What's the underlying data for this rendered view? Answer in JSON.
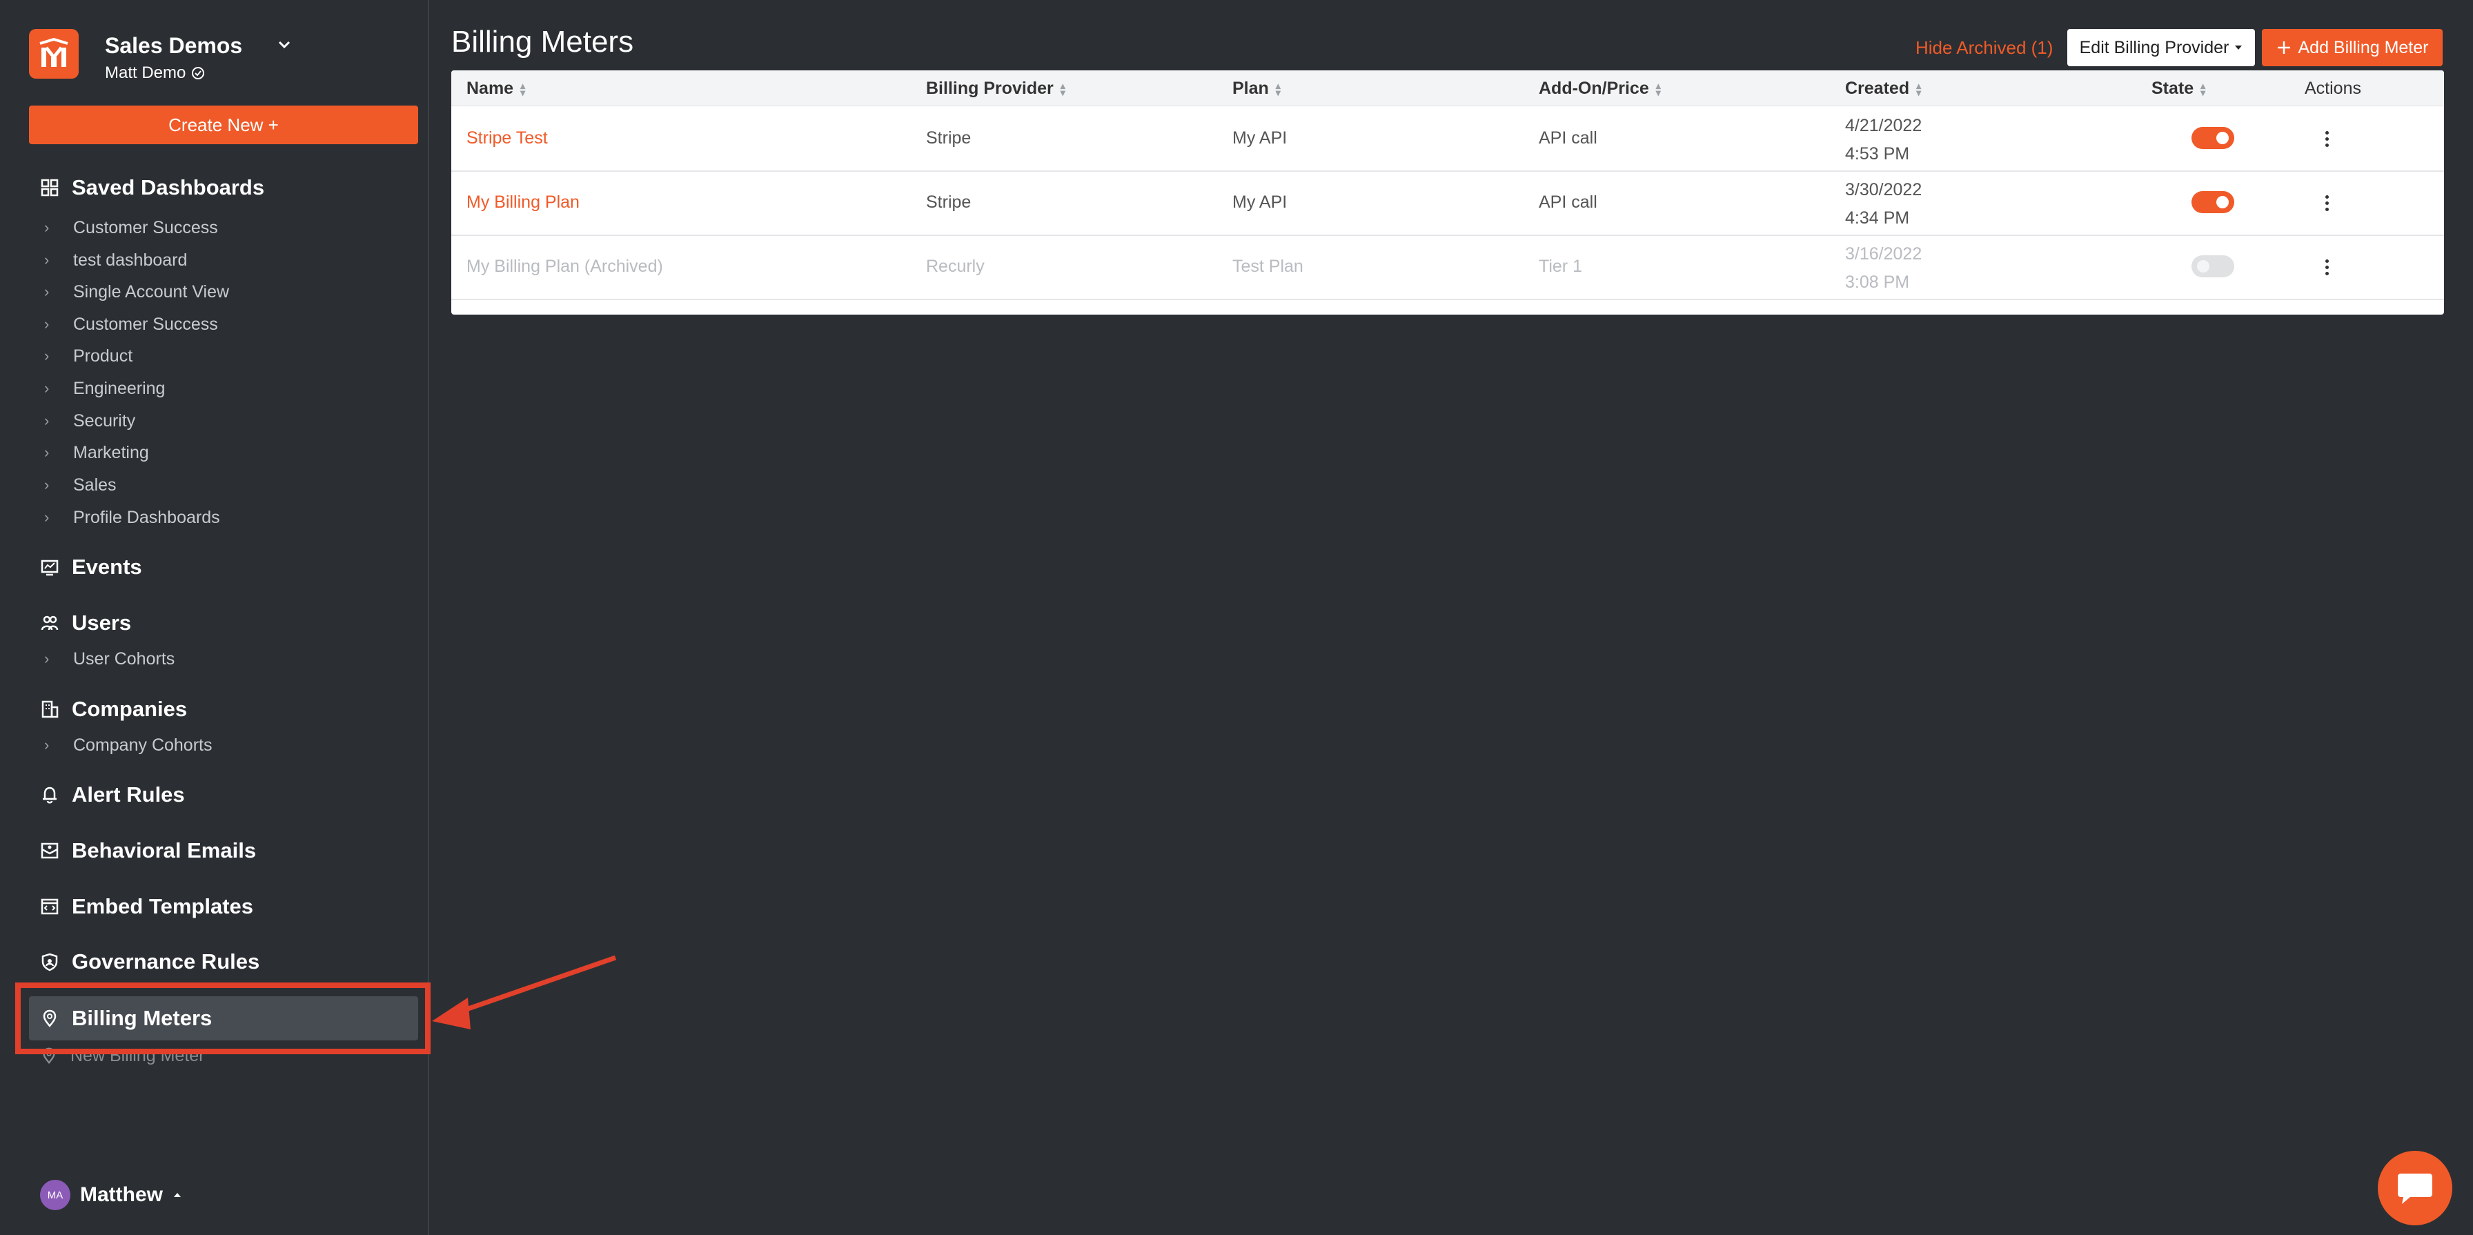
{
  "sidebar": {
    "org_name": "Sales Demos",
    "user_name": "Matt Demo",
    "create_label": "Create New +",
    "saved_dashboards": {
      "label": "Saved Dashboards",
      "items": [
        "Customer Success",
        "test dashboard",
        "Single Account View",
        "Customer Success",
        "Product",
        "Engineering",
        "Security",
        "Marketing",
        "Sales",
        "Profile Dashboards"
      ]
    },
    "events_label": "Events",
    "users": {
      "label": "Users",
      "items": [
        "User Cohorts"
      ]
    },
    "companies": {
      "label": "Companies",
      "items": [
        "Company Cohorts"
      ]
    },
    "alert_rules_label": "Alert Rules",
    "behavioral_emails_label": "Behavioral Emails",
    "embed_templates_label": "Embed Templates",
    "governance_rules_label": "Governance Rules",
    "billing_meters": {
      "label": "Billing Meters",
      "items": [
        "New Billing Meter"
      ]
    },
    "bottom_user": {
      "initials": "MA",
      "name": "Matthew"
    }
  },
  "header": {
    "title": "Billing Meters",
    "hide_archived": "Hide Archived (1)",
    "edit_provider": "Edit Billing Provider",
    "add_meter": "Add Billing Meter"
  },
  "table": {
    "columns": [
      "Name",
      "Billing Provider",
      "Plan",
      "Add-On/Price",
      "Created",
      "State",
      "Actions"
    ],
    "rows": [
      {
        "name": "Stripe Test",
        "provider": "Stripe",
        "plan": "My API",
        "addon": "API call",
        "created_date": "4/21/2022",
        "created_time": "4:53 PM",
        "state": "on",
        "archived": false
      },
      {
        "name": "My Billing Plan",
        "provider": "Stripe",
        "plan": "My API",
        "addon": "API call",
        "created_date": "3/30/2022",
        "created_time": "4:34 PM",
        "state": "on",
        "archived": false
      },
      {
        "name": "My Billing Plan (Archived)",
        "provider": "Recurly",
        "plan": "Test Plan",
        "addon": "Tier 1",
        "created_date": "3/16/2022",
        "created_time": "3:08 PM",
        "state": "off",
        "archived": true
      }
    ]
  },
  "colors": {
    "accent": "#f05a28",
    "background": "#2b2f33",
    "annotation": "#e2402a"
  }
}
